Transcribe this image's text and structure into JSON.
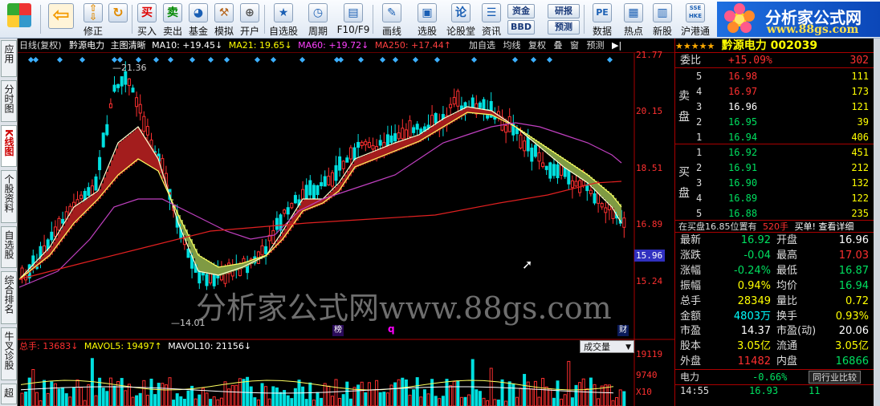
{
  "toolbar": {
    "buttons": [
      {
        "label": "",
        "icon": "home-grid-icon"
      },
      {
        "label": "",
        "icon": "back-arrow-icon"
      },
      {
        "label": "修正",
        "icon": "updown-icon"
      },
      {
        "label": "买入",
        "glyph": "买"
      },
      {
        "label": "卖出",
        "glyph": "卖"
      },
      {
        "label": "基金",
        "icon": "fund-icon"
      },
      {
        "label": "模拟",
        "icon": "hammer-icon"
      },
      {
        "label": "开户",
        "icon": "lock-icon"
      },
      {
        "label": "自选股",
        "icon": "star-icon"
      },
      {
        "label": "周期",
        "icon": "clock-icon"
      },
      {
        "label": "F10/F9",
        "icon": "f10-icon"
      },
      {
        "label": "画线",
        "icon": "pen-icon"
      },
      {
        "label": "选股",
        "icon": "screen-icon"
      },
      {
        "label": "论股堂",
        "glyph": "论"
      },
      {
        "label": "资讯",
        "icon": "news-icon"
      },
      {
        "label": "数据",
        "glyph": "PE"
      },
      {
        "label": "热点",
        "icon": "hot-icon"
      },
      {
        "label": "新股",
        "icon": "newstock-icon"
      },
      {
        "label": "沪港通",
        "glyph": "SSE HKE"
      }
    ],
    "small": {
      "fund": "资金",
      "bbd": "BBD",
      "research": "研报",
      "forecast": "预测"
    }
  },
  "logo": {
    "title": "分析家公式网",
    "url": "www.88gs.com"
  },
  "left_tabs": [
    "应用",
    "分时图",
    "K线图",
    "个股资料",
    "自选股",
    "综合排名",
    "牛叉诊股",
    "超"
  ],
  "chart": {
    "header": {
      "period": "日线(复权)",
      "name": "黔源电力",
      "mode": "主图清晰",
      "ma10": "MA10: +19.45↓",
      "ma21": "MA21: 19.65↓",
      "ma60": "MA60: +19.72↓",
      "ma250": "MA250: +17.44↑"
    },
    "tools": [
      "加自选",
      "均线",
      "复权",
      "叠",
      "窗",
      "预测"
    ],
    "price_labels": [
      "21.77",
      "20.15",
      "18.51",
      "16.89",
      "15.24"
    ],
    "current_price": "15.96",
    "high_mark": "21.36",
    "low_mark": "14.01",
    "markers": {
      "bang": "榜",
      "q": "q",
      "cai": "财"
    },
    "watermark": "分析家公式网www.88gs.com",
    "volume": {
      "header": {
        "label": "总手: 13683↓",
        "mavol5": "MAVOL5: 19497↑",
        "mavol10": "MAVOL10: 21156↓"
      },
      "selector": "成交量",
      "labels": [
        "19119",
        "9740"
      ],
      "unit": "X10"
    },
    "colors": {
      "red": "#ff3030",
      "green": "#00e060",
      "cyan": "#00ffff",
      "ma_red": "#e02020",
      "ma_purple": "#c040c0",
      "ribbon_red": "#a31d1d",
      "ribbon_green": "#7f9a43"
    }
  },
  "quote": {
    "title": "黔源电力 002039",
    "webi": {
      "label": "委比",
      "pct": "+15.09%",
      "diff": "302"
    },
    "sell": {
      "label": "卖盘",
      "rows": [
        {
          "lvl": "5",
          "price": "16.98",
          "vol": "111"
        },
        {
          "lvl": "4",
          "price": "16.97",
          "vol": "173"
        },
        {
          "lvl": "3",
          "price": "16.96",
          "vol": "121"
        },
        {
          "lvl": "2",
          "price": "16.95",
          "vol": "39"
        },
        {
          "lvl": "1",
          "price": "16.94",
          "vol": "406"
        }
      ]
    },
    "buy": {
      "label": "买盘",
      "rows": [
        {
          "lvl": "1",
          "price": "16.92",
          "vol": "451"
        },
        {
          "lvl": "2",
          "price": "16.91",
          "vol": "212"
        },
        {
          "lvl": "3",
          "price": "16.90",
          "vol": "132"
        },
        {
          "lvl": "4",
          "price": "16.89",
          "vol": "122"
        },
        {
          "lvl": "5",
          "price": "16.88",
          "vol": "235"
        }
      ]
    },
    "notice": {
      "text": "在买盘16.85位置有",
      "amount": "520手",
      "tail": "买单! 查看详细"
    },
    "stats": [
      {
        "k1": "最新",
        "v1": "16.92",
        "k2": "开盘",
        "v2": "16.96",
        "c1": "#00e060",
        "c2": "#ffffff"
      },
      {
        "k1": "涨跌",
        "v1": "-0.04",
        "k2": "最高",
        "v2": "17.03",
        "c1": "#00e060",
        "c2": "#ff3030"
      },
      {
        "k1": "涨幅",
        "v1": "-0.24%",
        "k2": "最低",
        "v2": "16.87",
        "c1": "#00e060",
        "c2": "#00e060"
      },
      {
        "k1": "振幅",
        "v1": "0.94%",
        "k2": "均价",
        "v2": "16.94",
        "c1": "#ffff00",
        "c2": "#00e060"
      },
      {
        "k1": "总手",
        "v1": "28349",
        "k2": "量比",
        "v2": "0.72",
        "c1": "#ffff00",
        "c2": "#ffff00"
      },
      {
        "k1": "金额",
        "v1": "4803万",
        "k2": "换手",
        "v2": "0.93%",
        "c1": "#00ffff",
        "c2": "#ffff00"
      },
      {
        "k1": "市盈",
        "v1": "14.37",
        "k2": "市盈(动)",
        "v2": "20.06",
        "c1": "#ffffff",
        "c2": "#ffffff"
      },
      {
        "k1": "股本",
        "v1": "3.05亿",
        "k2": "流通",
        "v2": "3.05亿",
        "c1": "#ffff00",
        "c2": "#ffff00"
      },
      {
        "k1": "外盘",
        "v1": "11482",
        "k2": "内盘",
        "v2": "16866",
        "c1": "#ff3030",
        "c2": "#00e060"
      }
    ],
    "industry": {
      "name": "电力",
      "pct": "-0.66%",
      "button": "同行业比较"
    },
    "tick": {
      "time": "14:55",
      "price": "16.93",
      "vol": "11"
    }
  }
}
